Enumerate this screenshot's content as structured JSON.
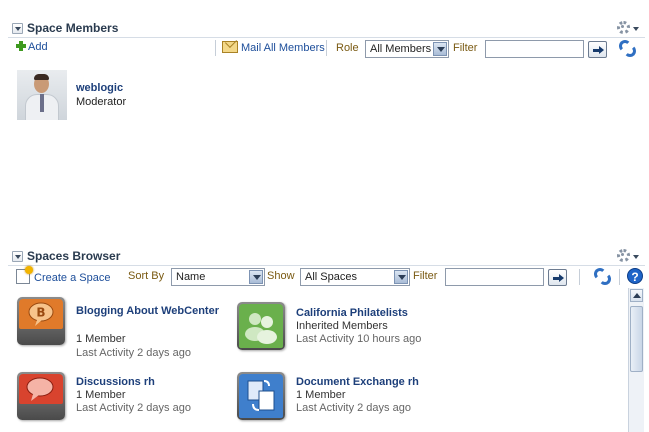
{
  "space_members": {
    "title": "Space Members",
    "toolbar": {
      "add_label": "Add",
      "mail_label": "Mail All Members",
      "role_label": "Role",
      "role_selected": "All Members",
      "filter_label": "Filter",
      "filter_value": ""
    },
    "members": [
      {
        "name": "weblogic",
        "role": "Moderator"
      }
    ]
  },
  "spaces_browser": {
    "title": "Spaces Browser",
    "toolbar": {
      "create_label": "Create a Space",
      "sort_by_label": "Sort By",
      "sort_by_selected": "Name",
      "show_label": "Show",
      "show_selected": "All Spaces",
      "filter_label": "Filter",
      "filter_value": ""
    },
    "spaces": [
      {
        "title": "Blogging About WebCenter",
        "members": "1 Member",
        "activity": "Last Activity 2 days ago",
        "icon": "blog-icon",
        "color": "#e07a2a"
      },
      {
        "title": "California Philatelists",
        "members": "Inherited Members",
        "activity": "Last Activity 10 hours ago",
        "icon": "group-icon",
        "color": "#6ab04c"
      },
      {
        "title": "Discussions rh",
        "members": "1 Member",
        "activity": "Last Activity 2 days ago",
        "icon": "discussion-icon",
        "color": "#d8432e"
      },
      {
        "title": "Document Exchange rh",
        "members": "1 Member",
        "activity": "Last Activity 2 days ago",
        "icon": "document-exchange-icon",
        "color": "#3f7fcc"
      }
    ]
  }
}
